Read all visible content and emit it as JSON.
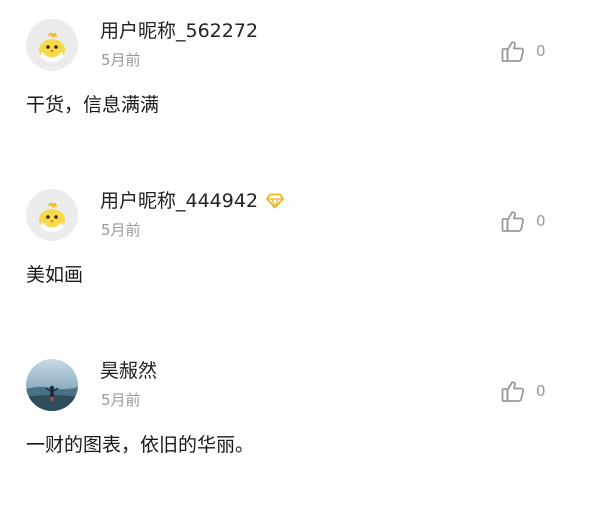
{
  "comments": [
    {
      "avatar": "chick-avatar",
      "username": "用户昵称_562272",
      "vip": false,
      "time": "5月前",
      "likes": "0",
      "content": "干货，信息满满"
    },
    {
      "avatar": "chick-avatar",
      "username": "用户昵称_444942",
      "vip": true,
      "time": "5月前",
      "likes": "0",
      "content": "美如画"
    },
    {
      "avatar": "photo-avatar",
      "username": "昊赧然",
      "vip": false,
      "time": "5月前",
      "likes": "0",
      "content": "一财的图表，依旧的华丽。"
    }
  ],
  "icons": {
    "like": "thumbs-up-icon",
    "vip": "diamond-icon"
  },
  "colors": {
    "username": "#222222",
    "meta": "#9a9a9a",
    "vip_badge": "#e8b820",
    "avatar_bg": "#ececec"
  }
}
